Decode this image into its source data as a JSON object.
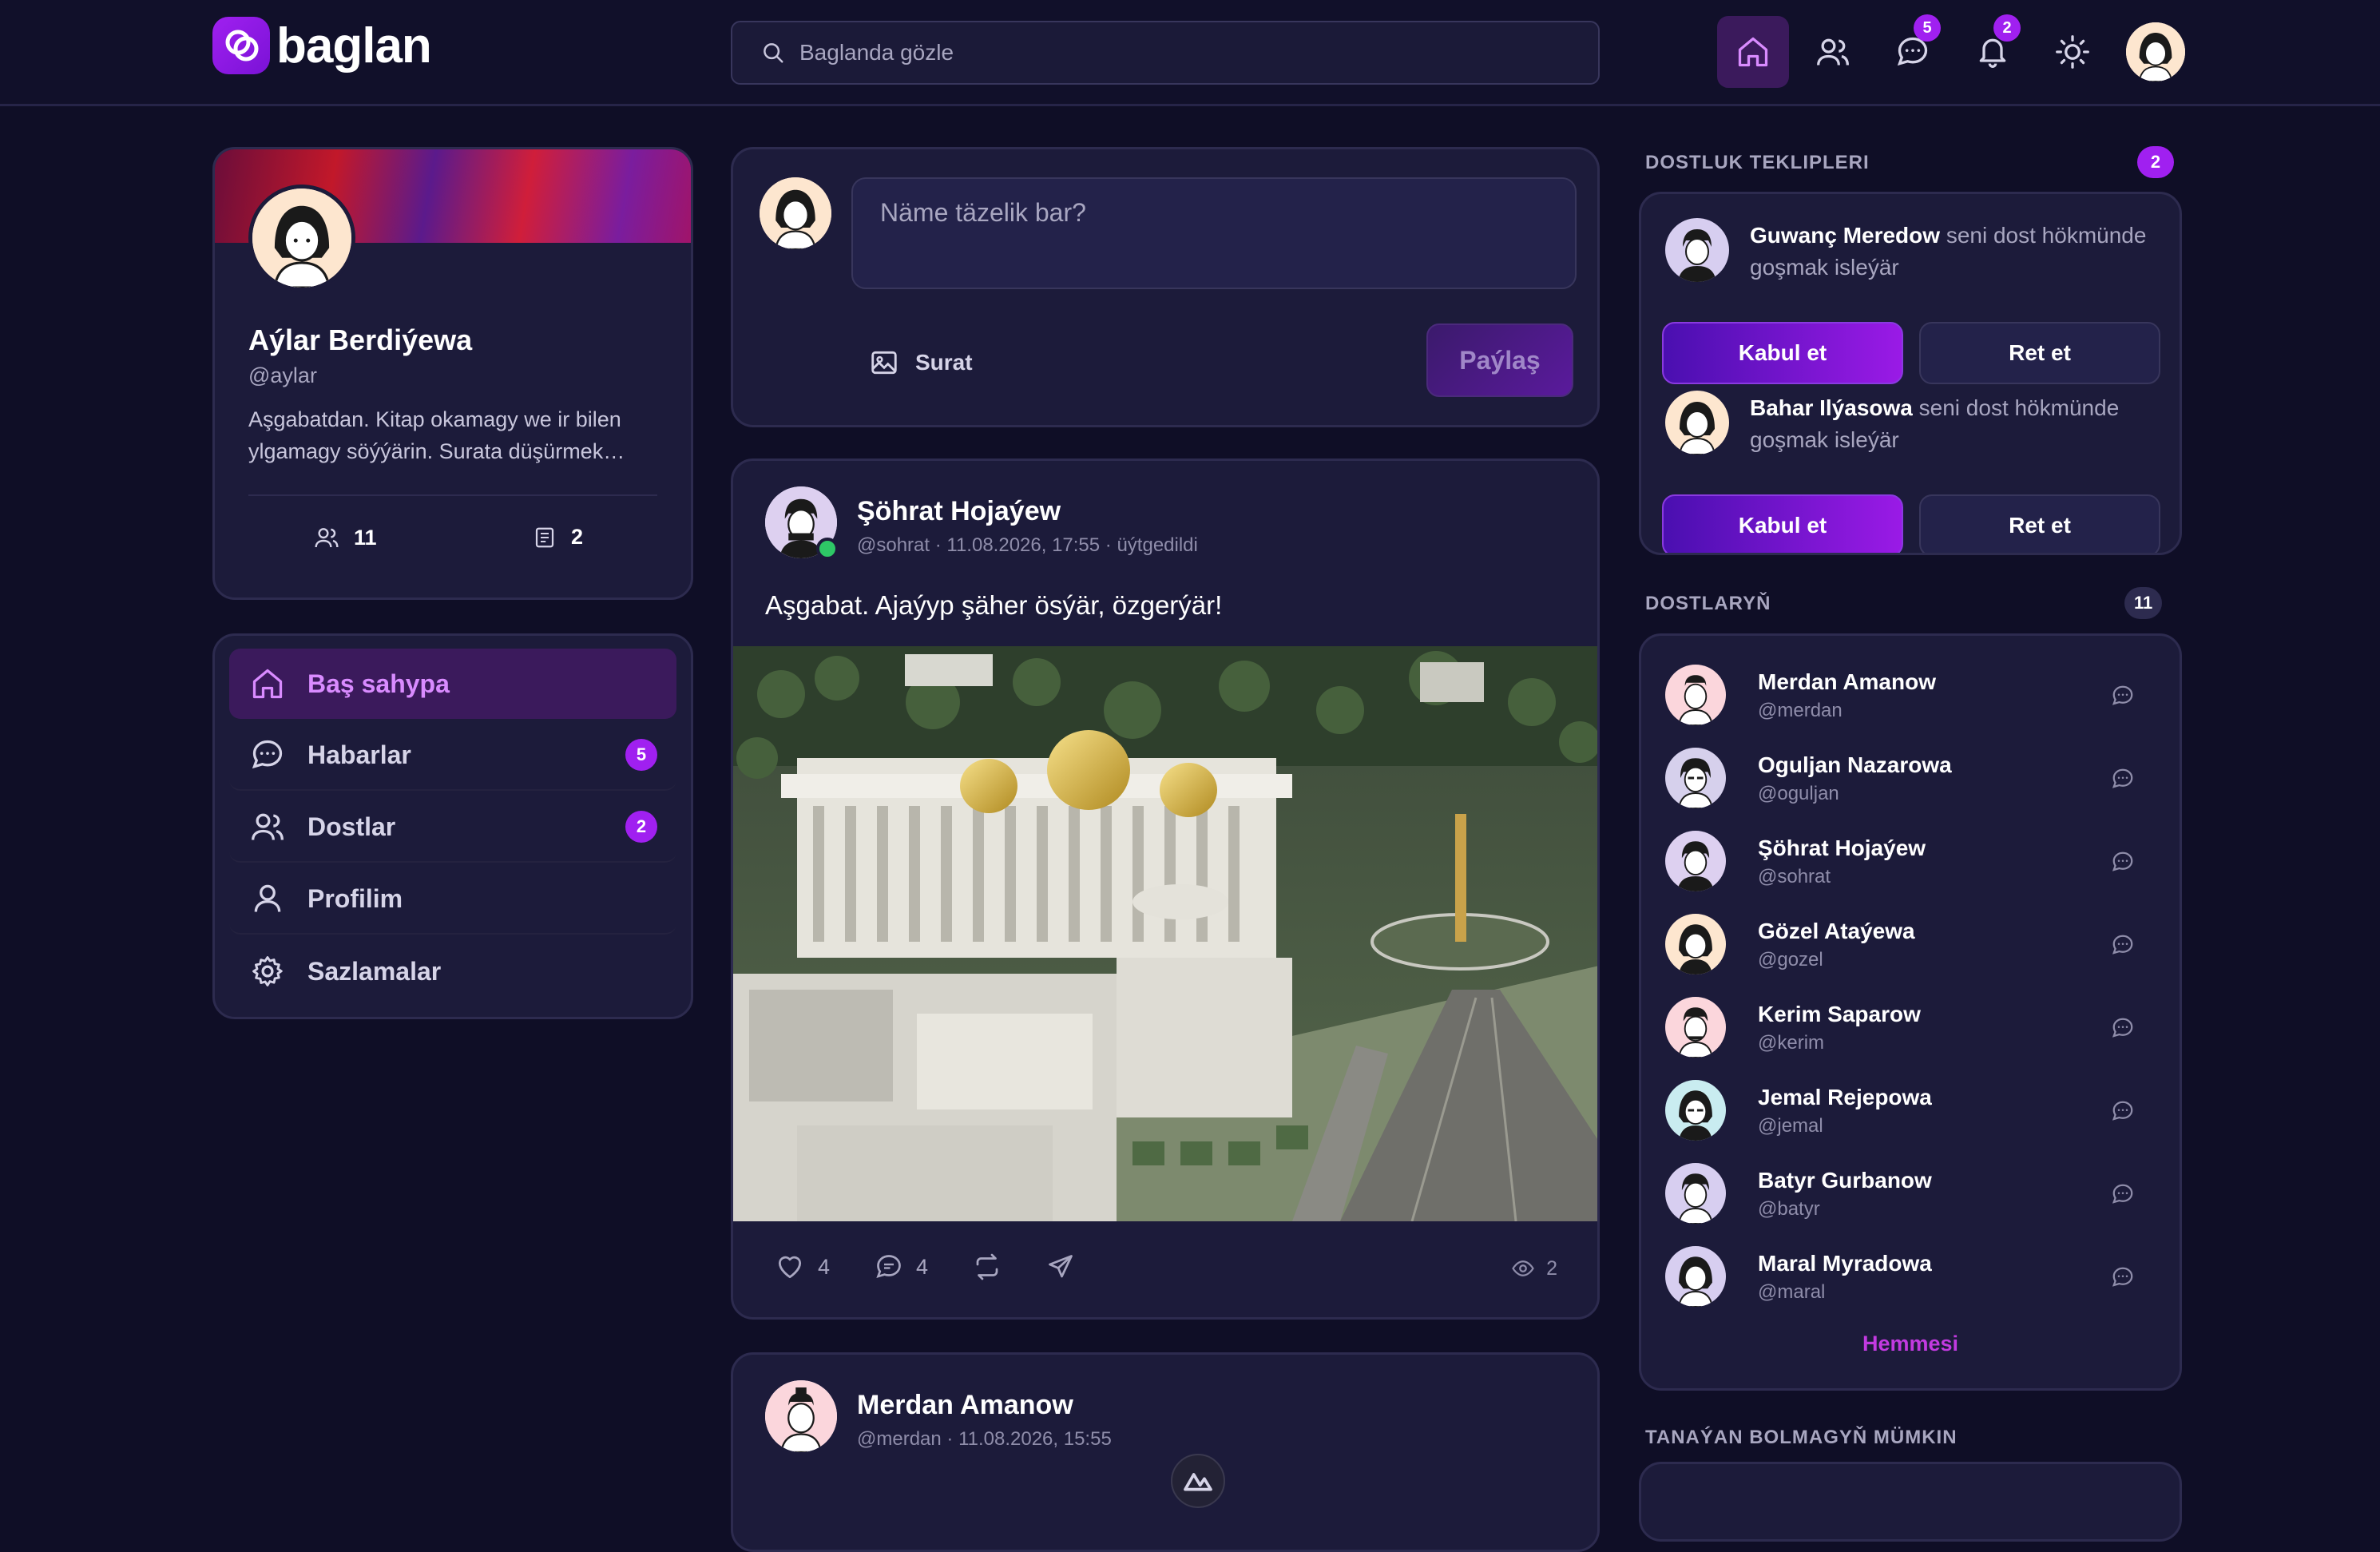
{
  "header": {
    "logo_text": "baglan",
    "search_placeholder": "Baglanda gözle",
    "messages_badge": "5",
    "notifications_badge": "2"
  },
  "profile": {
    "name": "Aýlar Berdiýewa",
    "handle": "@aylar",
    "bio": "Aşgabatdan. Kitap okamagy we ir bilen ylgamagy söýýärin. Surata düşürmek…",
    "friends_count": "11",
    "posts_count": "2"
  },
  "menu": {
    "items": [
      {
        "label": "Baş sahypa",
        "badge": ""
      },
      {
        "label": "Habarlar",
        "badge": "5"
      },
      {
        "label": "Dostlar",
        "badge": "2"
      },
      {
        "label": "Profilim",
        "badge": ""
      },
      {
        "label": "Sazlamalar",
        "badge": ""
      }
    ]
  },
  "composer": {
    "placeholder": "Näme täzelik bar?",
    "photo_label": "Surat",
    "share_label": "Paýlaş"
  },
  "posts": [
    {
      "author": "Şöhrat Hojaýew",
      "meta": "@sohrat · 11.08.2026, 17:55 · üýtgedildi",
      "text": "Aşgabat. Ajaýyp şäher ösýär, özgerýär!",
      "likes": "4",
      "comments": "4",
      "views": "2"
    },
    {
      "author": "Merdan Amanow",
      "meta": "@merdan · 11.08.2026, 15:55"
    }
  ],
  "requests": {
    "title": "DOSTLUK TEKLIPLERI",
    "count": "2",
    "items": [
      {
        "name": "Guwanç Meredow",
        "text": " seni dost hökmünde goşmak isleýär",
        "accept": "Kabul et",
        "reject": "Ret et"
      },
      {
        "name": "Bahar Ilýasowa",
        "text": " seni dost hökmünde goşmak isleýär",
        "accept": "Kabul et",
        "reject": "Ret et"
      }
    ]
  },
  "friends": {
    "title": "DOSTLARYŇ",
    "count": "11",
    "more_label": "Hemmesi",
    "items": [
      {
        "name": "Merdan Amanow",
        "handle": "@merdan"
      },
      {
        "name": "Oguljan Nazarowa",
        "handle": "@oguljan"
      },
      {
        "name": "Şöhrat Hojaýew",
        "handle": "@sohrat"
      },
      {
        "name": "Gözel Ataýewa",
        "handle": "@gozel"
      },
      {
        "name": "Kerim Saparow",
        "handle": "@kerim"
      },
      {
        "name": "Jemal Rejepowa",
        "handle": "@jemal"
      },
      {
        "name": "Batyr Gurbanow",
        "handle": "@batyr"
      },
      {
        "name": "Maral Myradowa",
        "handle": "@maral"
      }
    ]
  },
  "suggestions": {
    "title": "TANAÝAN BOLMAGYŇ MÜMKIN"
  },
  "colors": {
    "accent": "#a020f0",
    "background": "#0f0e26",
    "card": "#1c1b3a",
    "online": "#2ec866"
  }
}
